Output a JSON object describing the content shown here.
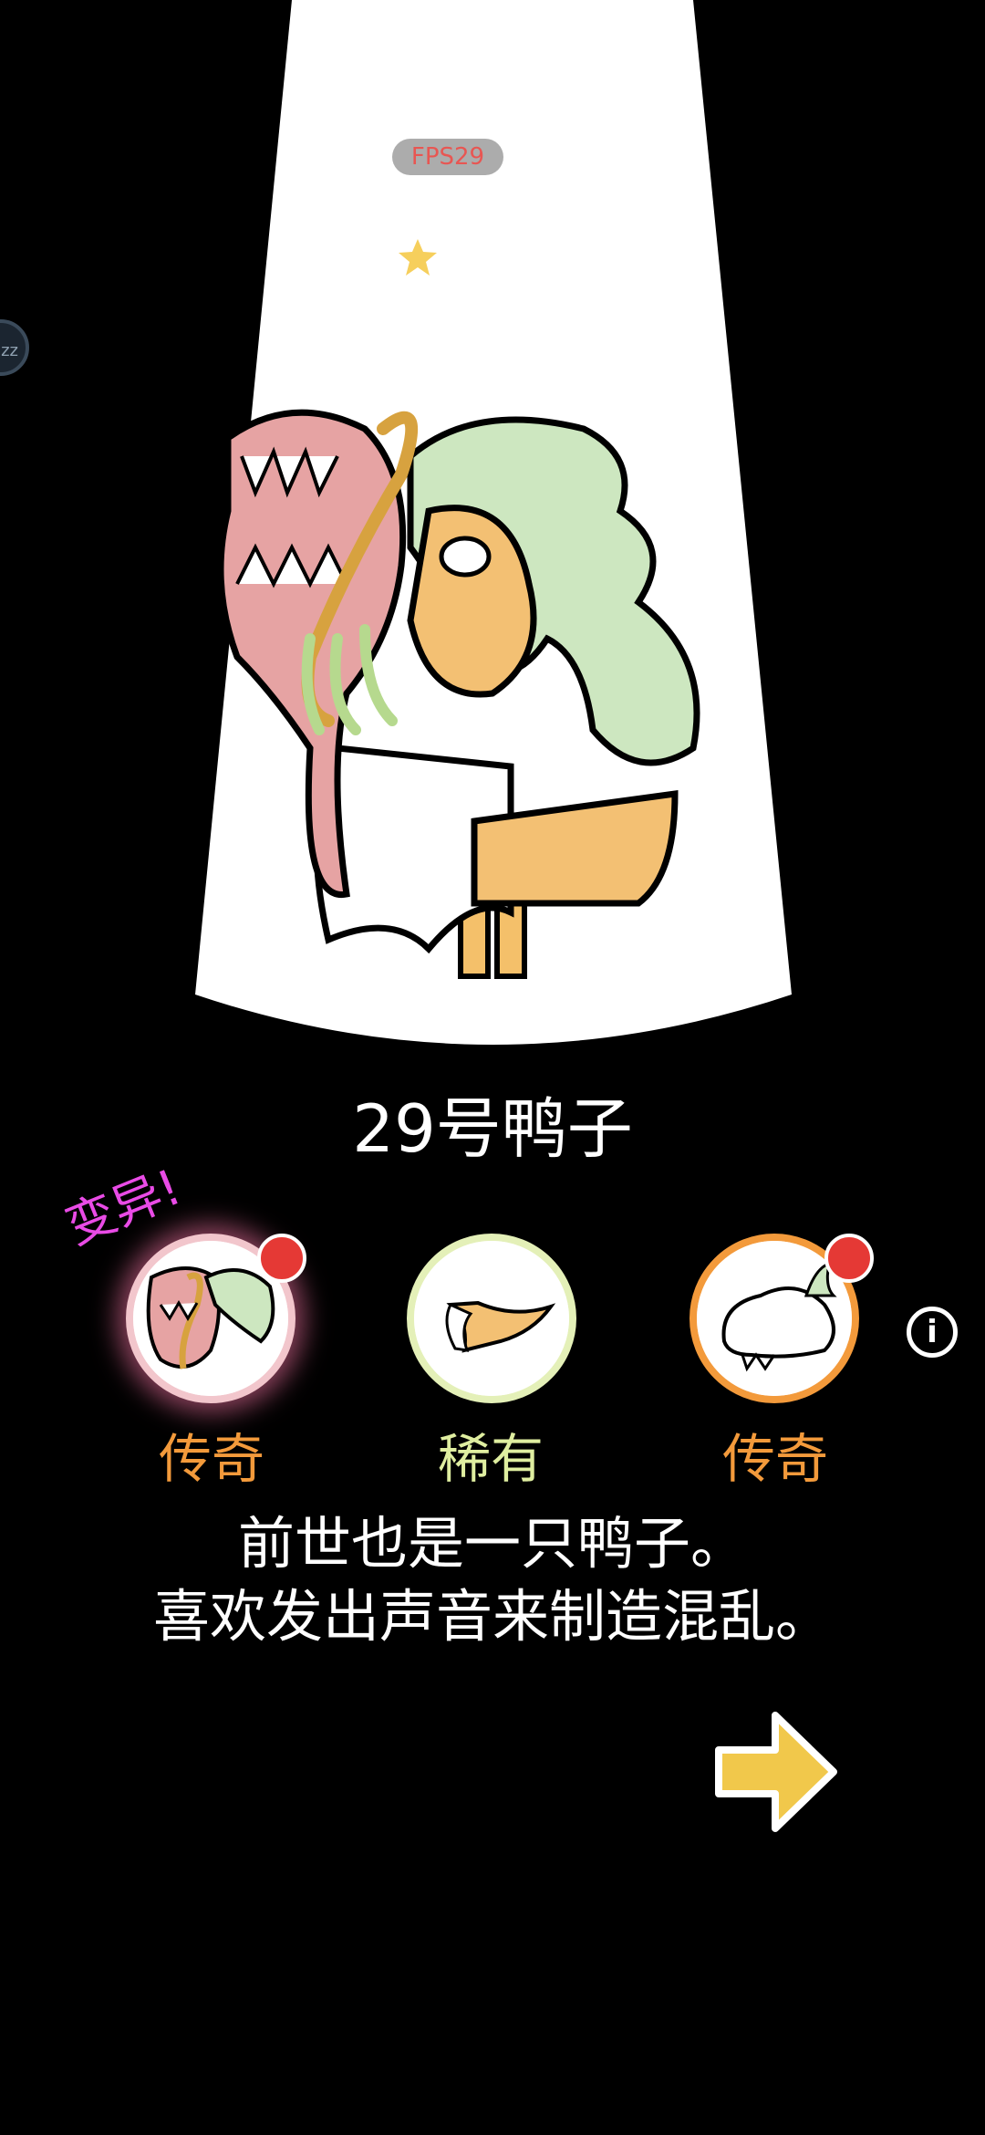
{
  "overlay": {
    "fps": "FPS29",
    "side_bubble": "zz"
  },
  "character": {
    "name": "29号鸭子",
    "mutation_label": "变异!"
  },
  "parts": [
    {
      "rarity": "传奇",
      "rarity_color": "#f39a3b",
      "icon": "dragon-mask-icon",
      "new": true
    },
    {
      "rarity": "稀有",
      "rarity_color": "#dfeea0",
      "icon": "duck-beak-icon",
      "new": false
    },
    {
      "rarity": "传奇",
      "rarity_color": "#f39a3b",
      "icon": "fluffy-tail-icon",
      "new": true
    }
  ],
  "description": {
    "line1": "前世也是一只鸭子。",
    "line2": "喜欢发出声音来制造混乱。"
  },
  "colors": {
    "spotlight": "#ffffff",
    "next_arrow": "#f1c84b",
    "background": "#000000"
  }
}
